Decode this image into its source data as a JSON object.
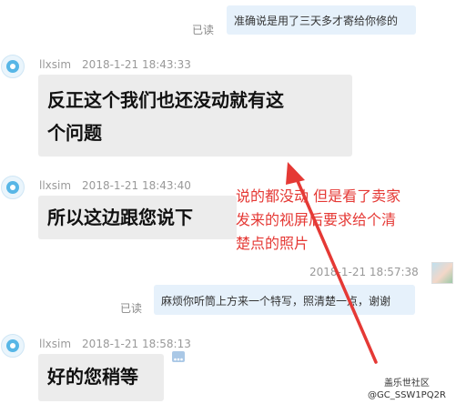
{
  "messages": [
    {
      "side": "out",
      "text": "准确说是用了三天多才寄给你修的",
      "read": "已读"
    },
    {
      "side": "in",
      "user": "llxsim",
      "time": "2018-1-21 18:43:33",
      "text_line1": "反正这个我们也还没动就有这",
      "text_line2": "个问题"
    },
    {
      "side": "in",
      "user": "llxsim",
      "time": "2018-1-21 18:43:40",
      "text": "所以这边跟您说下"
    },
    {
      "side": "out",
      "time": "2018-1-21 18:57:38",
      "text": "麻烦你听筒上方来一个特写，照清楚一点，谢谢",
      "read": "已读"
    },
    {
      "side": "in",
      "user": "llxsim",
      "time": "2018-1-21 18:58:13",
      "text": "好的您稍等"
    }
  ],
  "annotation": {
    "line1": "说的都没动  但是看了卖家",
    "line2": "发来的视屏后要求给个清",
    "line3": "楚点的照片",
    "color": "#e53935"
  },
  "watermark": {
    "line1": "盖乐世社区",
    "line2": "@GC_SSW1PQ2R"
  }
}
